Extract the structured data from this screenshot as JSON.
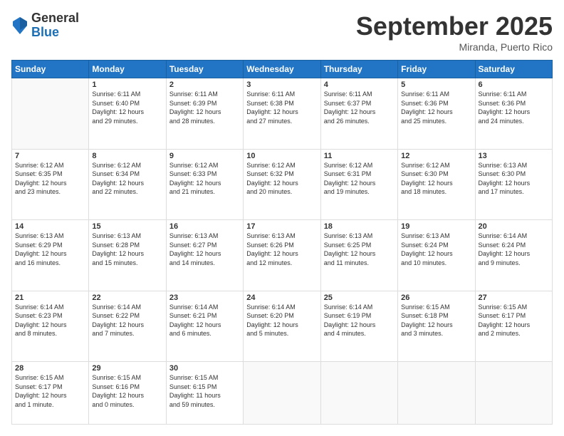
{
  "logo": {
    "general": "General",
    "blue": "Blue"
  },
  "header": {
    "month": "September 2025",
    "location": "Miranda, Puerto Rico"
  },
  "weekdays": [
    "Sunday",
    "Monday",
    "Tuesday",
    "Wednesday",
    "Thursday",
    "Friday",
    "Saturday"
  ],
  "weeks": [
    [
      {
        "day": "",
        "info": ""
      },
      {
        "day": "1",
        "info": "Sunrise: 6:11 AM\nSunset: 6:40 PM\nDaylight: 12 hours\nand 29 minutes."
      },
      {
        "day": "2",
        "info": "Sunrise: 6:11 AM\nSunset: 6:39 PM\nDaylight: 12 hours\nand 28 minutes."
      },
      {
        "day": "3",
        "info": "Sunrise: 6:11 AM\nSunset: 6:38 PM\nDaylight: 12 hours\nand 27 minutes."
      },
      {
        "day": "4",
        "info": "Sunrise: 6:11 AM\nSunset: 6:37 PM\nDaylight: 12 hours\nand 26 minutes."
      },
      {
        "day": "5",
        "info": "Sunrise: 6:11 AM\nSunset: 6:36 PM\nDaylight: 12 hours\nand 25 minutes."
      },
      {
        "day": "6",
        "info": "Sunrise: 6:11 AM\nSunset: 6:36 PM\nDaylight: 12 hours\nand 24 minutes."
      }
    ],
    [
      {
        "day": "7",
        "info": "Sunrise: 6:12 AM\nSunset: 6:35 PM\nDaylight: 12 hours\nand 23 minutes."
      },
      {
        "day": "8",
        "info": "Sunrise: 6:12 AM\nSunset: 6:34 PM\nDaylight: 12 hours\nand 22 minutes."
      },
      {
        "day": "9",
        "info": "Sunrise: 6:12 AM\nSunset: 6:33 PM\nDaylight: 12 hours\nand 21 minutes."
      },
      {
        "day": "10",
        "info": "Sunrise: 6:12 AM\nSunset: 6:32 PM\nDaylight: 12 hours\nand 20 minutes."
      },
      {
        "day": "11",
        "info": "Sunrise: 6:12 AM\nSunset: 6:31 PM\nDaylight: 12 hours\nand 19 minutes."
      },
      {
        "day": "12",
        "info": "Sunrise: 6:12 AM\nSunset: 6:30 PM\nDaylight: 12 hours\nand 18 minutes."
      },
      {
        "day": "13",
        "info": "Sunrise: 6:13 AM\nSunset: 6:30 PM\nDaylight: 12 hours\nand 17 minutes."
      }
    ],
    [
      {
        "day": "14",
        "info": "Sunrise: 6:13 AM\nSunset: 6:29 PM\nDaylight: 12 hours\nand 16 minutes."
      },
      {
        "day": "15",
        "info": "Sunrise: 6:13 AM\nSunset: 6:28 PM\nDaylight: 12 hours\nand 15 minutes."
      },
      {
        "day": "16",
        "info": "Sunrise: 6:13 AM\nSunset: 6:27 PM\nDaylight: 12 hours\nand 14 minutes."
      },
      {
        "day": "17",
        "info": "Sunrise: 6:13 AM\nSunset: 6:26 PM\nDaylight: 12 hours\nand 12 minutes."
      },
      {
        "day": "18",
        "info": "Sunrise: 6:13 AM\nSunset: 6:25 PM\nDaylight: 12 hours\nand 11 minutes."
      },
      {
        "day": "19",
        "info": "Sunrise: 6:13 AM\nSunset: 6:24 PM\nDaylight: 12 hours\nand 10 minutes."
      },
      {
        "day": "20",
        "info": "Sunrise: 6:14 AM\nSunset: 6:24 PM\nDaylight: 12 hours\nand 9 minutes."
      }
    ],
    [
      {
        "day": "21",
        "info": "Sunrise: 6:14 AM\nSunset: 6:23 PM\nDaylight: 12 hours\nand 8 minutes."
      },
      {
        "day": "22",
        "info": "Sunrise: 6:14 AM\nSunset: 6:22 PM\nDaylight: 12 hours\nand 7 minutes."
      },
      {
        "day": "23",
        "info": "Sunrise: 6:14 AM\nSunset: 6:21 PM\nDaylight: 12 hours\nand 6 minutes."
      },
      {
        "day": "24",
        "info": "Sunrise: 6:14 AM\nSunset: 6:20 PM\nDaylight: 12 hours\nand 5 minutes."
      },
      {
        "day": "25",
        "info": "Sunrise: 6:14 AM\nSunset: 6:19 PM\nDaylight: 12 hours\nand 4 minutes."
      },
      {
        "day": "26",
        "info": "Sunrise: 6:15 AM\nSunset: 6:18 PM\nDaylight: 12 hours\nand 3 minutes."
      },
      {
        "day": "27",
        "info": "Sunrise: 6:15 AM\nSunset: 6:17 PM\nDaylight: 12 hours\nand 2 minutes."
      }
    ],
    [
      {
        "day": "28",
        "info": "Sunrise: 6:15 AM\nSunset: 6:17 PM\nDaylight: 12 hours\nand 1 minute."
      },
      {
        "day": "29",
        "info": "Sunrise: 6:15 AM\nSunset: 6:16 PM\nDaylight: 12 hours\nand 0 minutes."
      },
      {
        "day": "30",
        "info": "Sunrise: 6:15 AM\nSunset: 6:15 PM\nDaylight: 11 hours\nand 59 minutes."
      },
      {
        "day": "",
        "info": ""
      },
      {
        "day": "",
        "info": ""
      },
      {
        "day": "",
        "info": ""
      },
      {
        "day": "",
        "info": ""
      }
    ]
  ]
}
